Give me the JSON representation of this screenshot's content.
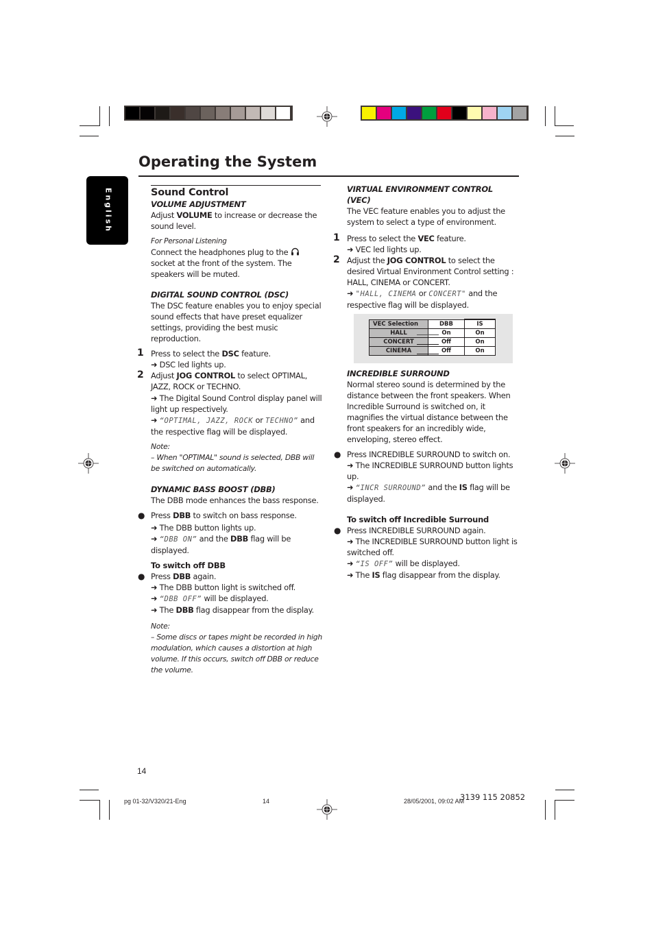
{
  "registration": {
    "grayscale_swatches": [
      "#000000",
      "#050304",
      "#1e1a17",
      "#3a2f2b",
      "#4f4643",
      "#6b625d",
      "#887d78",
      "#a59b97",
      "#c2b9b5",
      "#dfdbd8",
      "#ffffff"
    ],
    "color_swatches": [
      "#f9f200",
      "#e5007e",
      "#00a8e5",
      "#3b117d",
      "#009e3e",
      "#e2001b",
      "#000000",
      "#fffbb0",
      "#f6b3cb",
      "#9fd4f2",
      "#a3a3a3"
    ]
  },
  "language_tab": "English",
  "page_title": "Operating the System",
  "left": {
    "section_title": "Sound Control",
    "volume": {
      "heading": "VOLUME ADJUSTMENT",
      "text_pre": "Adjust ",
      "text_bold": "VOLUME",
      "text_post": " to increase or decrease the sound level.",
      "sub_heading": "For Personal Listening",
      "personal_pre": "Connect the headphones plug to the ",
      "personal_icon": "headphones-icon",
      "personal_post": " socket at the front of the system. The speakers will be muted."
    },
    "dsc": {
      "heading": "DIGITAL SOUND CONTROL  (DSC)",
      "intro": "The DSC feature enables you to enjoy special sound effects that have preset equalizer settings, providing the best music reproduction.",
      "step1_num": "1",
      "step1_pre": "Press to select the ",
      "step1_bold": "DSC",
      "step1_post": " feature.",
      "step1_result": "DSC led lights up.",
      "step2_num": "2",
      "step2_pre": "Adjust ",
      "step2_bold": "JOG CONTROL",
      "step2_post": " to select OPTIMAL, JAZZ, ROCK or TECHNO.",
      "step2_result1": "The Digital Sound Control display panel will light up respectively.",
      "step2_result2_lcd": "“OPTIMAL, JAZZ, ROCK",
      "step2_result2_or": " or ",
      "step2_result2_lcd2": "TECHNO”",
      "step2_result2_post": " and the respective flag will be displayed.",
      "note_label": "Note:",
      "note_text": "–  When \"OPTIMAL\" sound is selected, DBB will be switched on automatically."
    },
    "dbb": {
      "heading": "DYNAMIC BASS BOOST (DBB)",
      "intro": "The DBB mode enhances the bass response.",
      "bullet1_pre": "Press ",
      "bullet1_bold": "DBB",
      "bullet1_post": " to switch on bass response.",
      "bullet1_result1": "The DBB button lights up.",
      "bullet1_result2_lcd": "“DBB ON”",
      "bullet1_result2_mid": " and the ",
      "bullet1_result2_flag": "DBB",
      "bullet1_result2_post": " flag will be displayed.",
      "off_heading": "To switch off DBB",
      "bullet2_pre": "Press ",
      "bullet2_bold": "DBB",
      "bullet2_post": " again.",
      "bullet2_result1": "The DBB button light is switched off.",
      "bullet2_result2_lcd": "“DBB OFF”",
      "bullet2_result2_post": " will be displayed.",
      "bullet2_result3_pre": "The ",
      "bullet2_result3_flag": "DBB",
      "bullet2_result3_post": " flag disappear from the display.",
      "note_label": "Note:",
      "note_text": "–  Some discs or tapes might be recorded in high modulation, which causes a distortion at high volume. If this occurs, switch off DBB or reduce the volume."
    }
  },
  "right": {
    "vec": {
      "heading": "VIRTUAL ENVIRONMENT CONTROL (VEC)",
      "intro": "The VEC feature enables you to adjust the system to select a type of environment.",
      "step1_num": "1",
      "step1_pre": "Press to select the ",
      "step1_bold": "VEC",
      "step1_post": " feature.",
      "step1_result": "VEC led lights up.",
      "step2_num": "2",
      "step2_pre": "Adjust the ",
      "step2_bold": "JOG CONTROL",
      "step2_post": " to select the desired Virtual Environment Control setting : HALL, CINEMA or CONCERT.",
      "step2_result_lcd": "\"HALL, CINEMA",
      "step2_result_or": " or ",
      "step2_result_lcd2": "CONCERT\"",
      "step2_result_post": " and the respective flag will be displayed.",
      "table": {
        "headers": [
          "VEC Selection",
          "DBB",
          "IS"
        ],
        "rows": [
          [
            "HALL",
            "On",
            "On"
          ],
          [
            "CONCERT",
            "Off",
            "On"
          ],
          [
            "CINEMA",
            "Off",
            "On"
          ]
        ]
      }
    },
    "is": {
      "heading": "INCREDIBLE SURROUND",
      "intro": "Normal stereo sound is determined by the distance between the front speakers. When Incredible Surround is switched on, it magnifies the virtual distance between the front speakers for an incredibly wide, enveloping,  stereo effect.",
      "bullet1": "Press INCREDIBLE SURROUND to switch on.",
      "bullet1_result1": "The INCREDIBLE SURROUND button lights up.",
      "bullet1_result2_lcd": "“INCR SURROUND”",
      "bullet1_result2_mid": " and the ",
      "bullet1_result2_flag": "IS",
      "bullet1_result2_post": " flag will be displayed.",
      "off_heading": "To switch off Incredible Surround",
      "bullet2": "Press INCREDIBLE SURROUND again.",
      "bullet2_result1": "The INCREDIBLE SURROUND button light is switched off.",
      "bullet2_result2_lcd": "“IS OFF”",
      "bullet2_result2_post": "  will be displayed.",
      "bullet2_result3_pre": "The ",
      "bullet2_result3_flag": "IS",
      "bullet2_result3_post": " flag disappear from the display."
    }
  },
  "page_number": "14",
  "footer": {
    "file": "pg 01-32/V320/21-Eng",
    "page": "14",
    "datetime": "28/05/2001, 09:02 AM",
    "code": "3139 115 20852"
  },
  "arrow_glyph": "➜",
  "bullet_glyph": "●"
}
